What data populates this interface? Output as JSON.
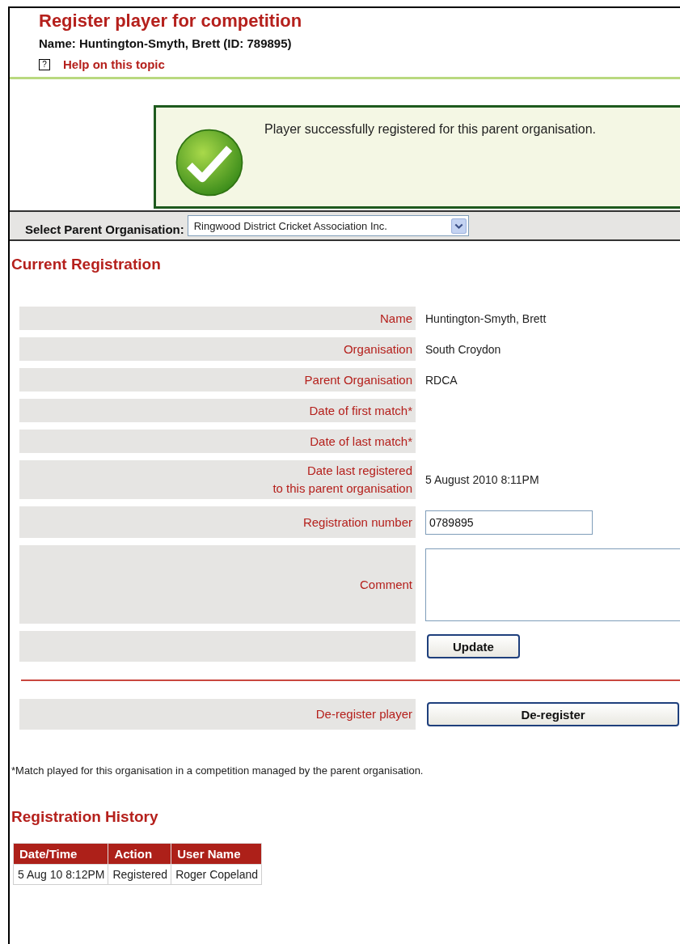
{
  "header": {
    "title": "Register player for competition",
    "subtitle": "Name: Huntington-Smyth, Brett (ID: 789895)",
    "help_icon": "?",
    "help_link": "Help on this topic"
  },
  "message": {
    "text": "Player successfully registered for this parent organisation."
  },
  "parent_select": {
    "label": "Select Parent Organisation:",
    "value": "Ringwood District Cricket Association Inc."
  },
  "current_registration": {
    "heading": "Current Registration",
    "rows": [
      {
        "kind": "text",
        "label": "Name",
        "value": "Huntington-Smyth, Brett"
      },
      {
        "kind": "text",
        "label": "Organisation",
        "value": "South Croydon"
      },
      {
        "kind": "text",
        "label": "Parent Organisation",
        "value": "RDCA"
      },
      {
        "kind": "text",
        "label": "Date of first match*"
      },
      {
        "kind": "text",
        "label": "Date of last match*"
      },
      {
        "kind": "text",
        "label": "Date last registered\nto this parent organisation",
        "value": "5 August 2010 8:11PM"
      },
      {
        "kind": "input",
        "label": "Registration number",
        "value": "0789895"
      },
      {
        "kind": "textarea",
        "label": "Comment"
      },
      {
        "kind": "button",
        "button": "Update"
      }
    ],
    "deregister": {
      "label": "De-register player",
      "button": "De-register"
    },
    "footnote": "*Match played for this organisation in a competition managed by the parent organisation."
  },
  "history": {
    "heading": "Registration History",
    "columns": [
      "Date/Time",
      "Action",
      "User Name"
    ],
    "rows": [
      [
        "5 Aug 10 8:12PM",
        "Registered",
        "Roger Copeland"
      ]
    ]
  }
}
